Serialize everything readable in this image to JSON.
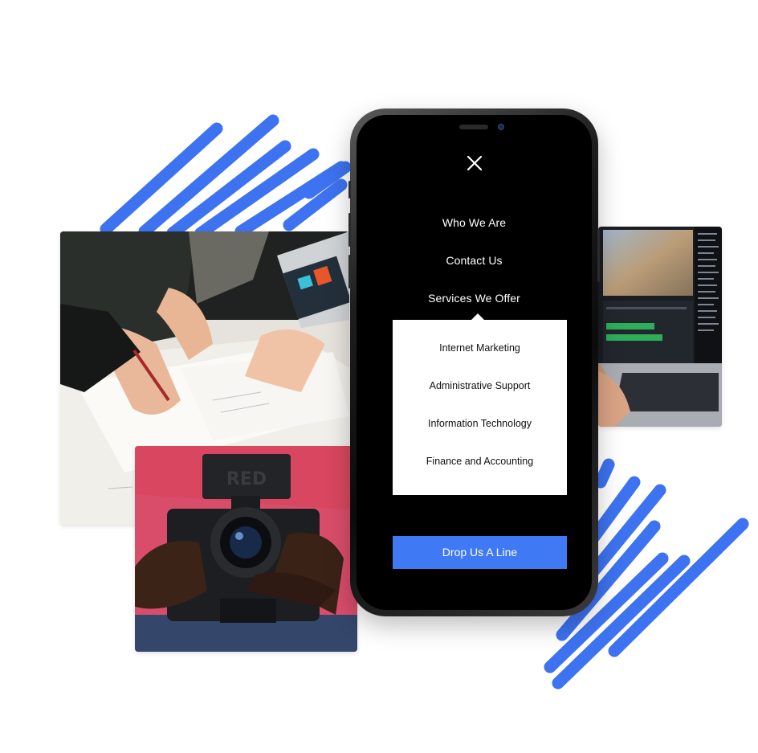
{
  "colors": {
    "accent": "#3f7af4",
    "stripe": "#3d72f0",
    "phone_screen": "#000000",
    "dropdown_bg": "#ffffff"
  },
  "nav": {
    "close_icon": "close-icon",
    "items": [
      {
        "label": "Who We Are"
      },
      {
        "label": "Contact Us"
      },
      {
        "label": "Services We Offer"
      }
    ]
  },
  "services_dropdown": {
    "items": [
      {
        "label": "Internet Marketing"
      },
      {
        "label": "Administrative Support"
      },
      {
        "label": "Information Technology"
      },
      {
        "label": "Finance and Accounting"
      }
    ]
  },
  "cta": {
    "label": "Drop Us A Line"
  },
  "photos": {
    "meeting_alt": "team-meeting-photo",
    "editing_alt": "video-editing-laptop-photo",
    "camera_alt": "video-camera-photo",
    "camera_brand": "RED"
  }
}
